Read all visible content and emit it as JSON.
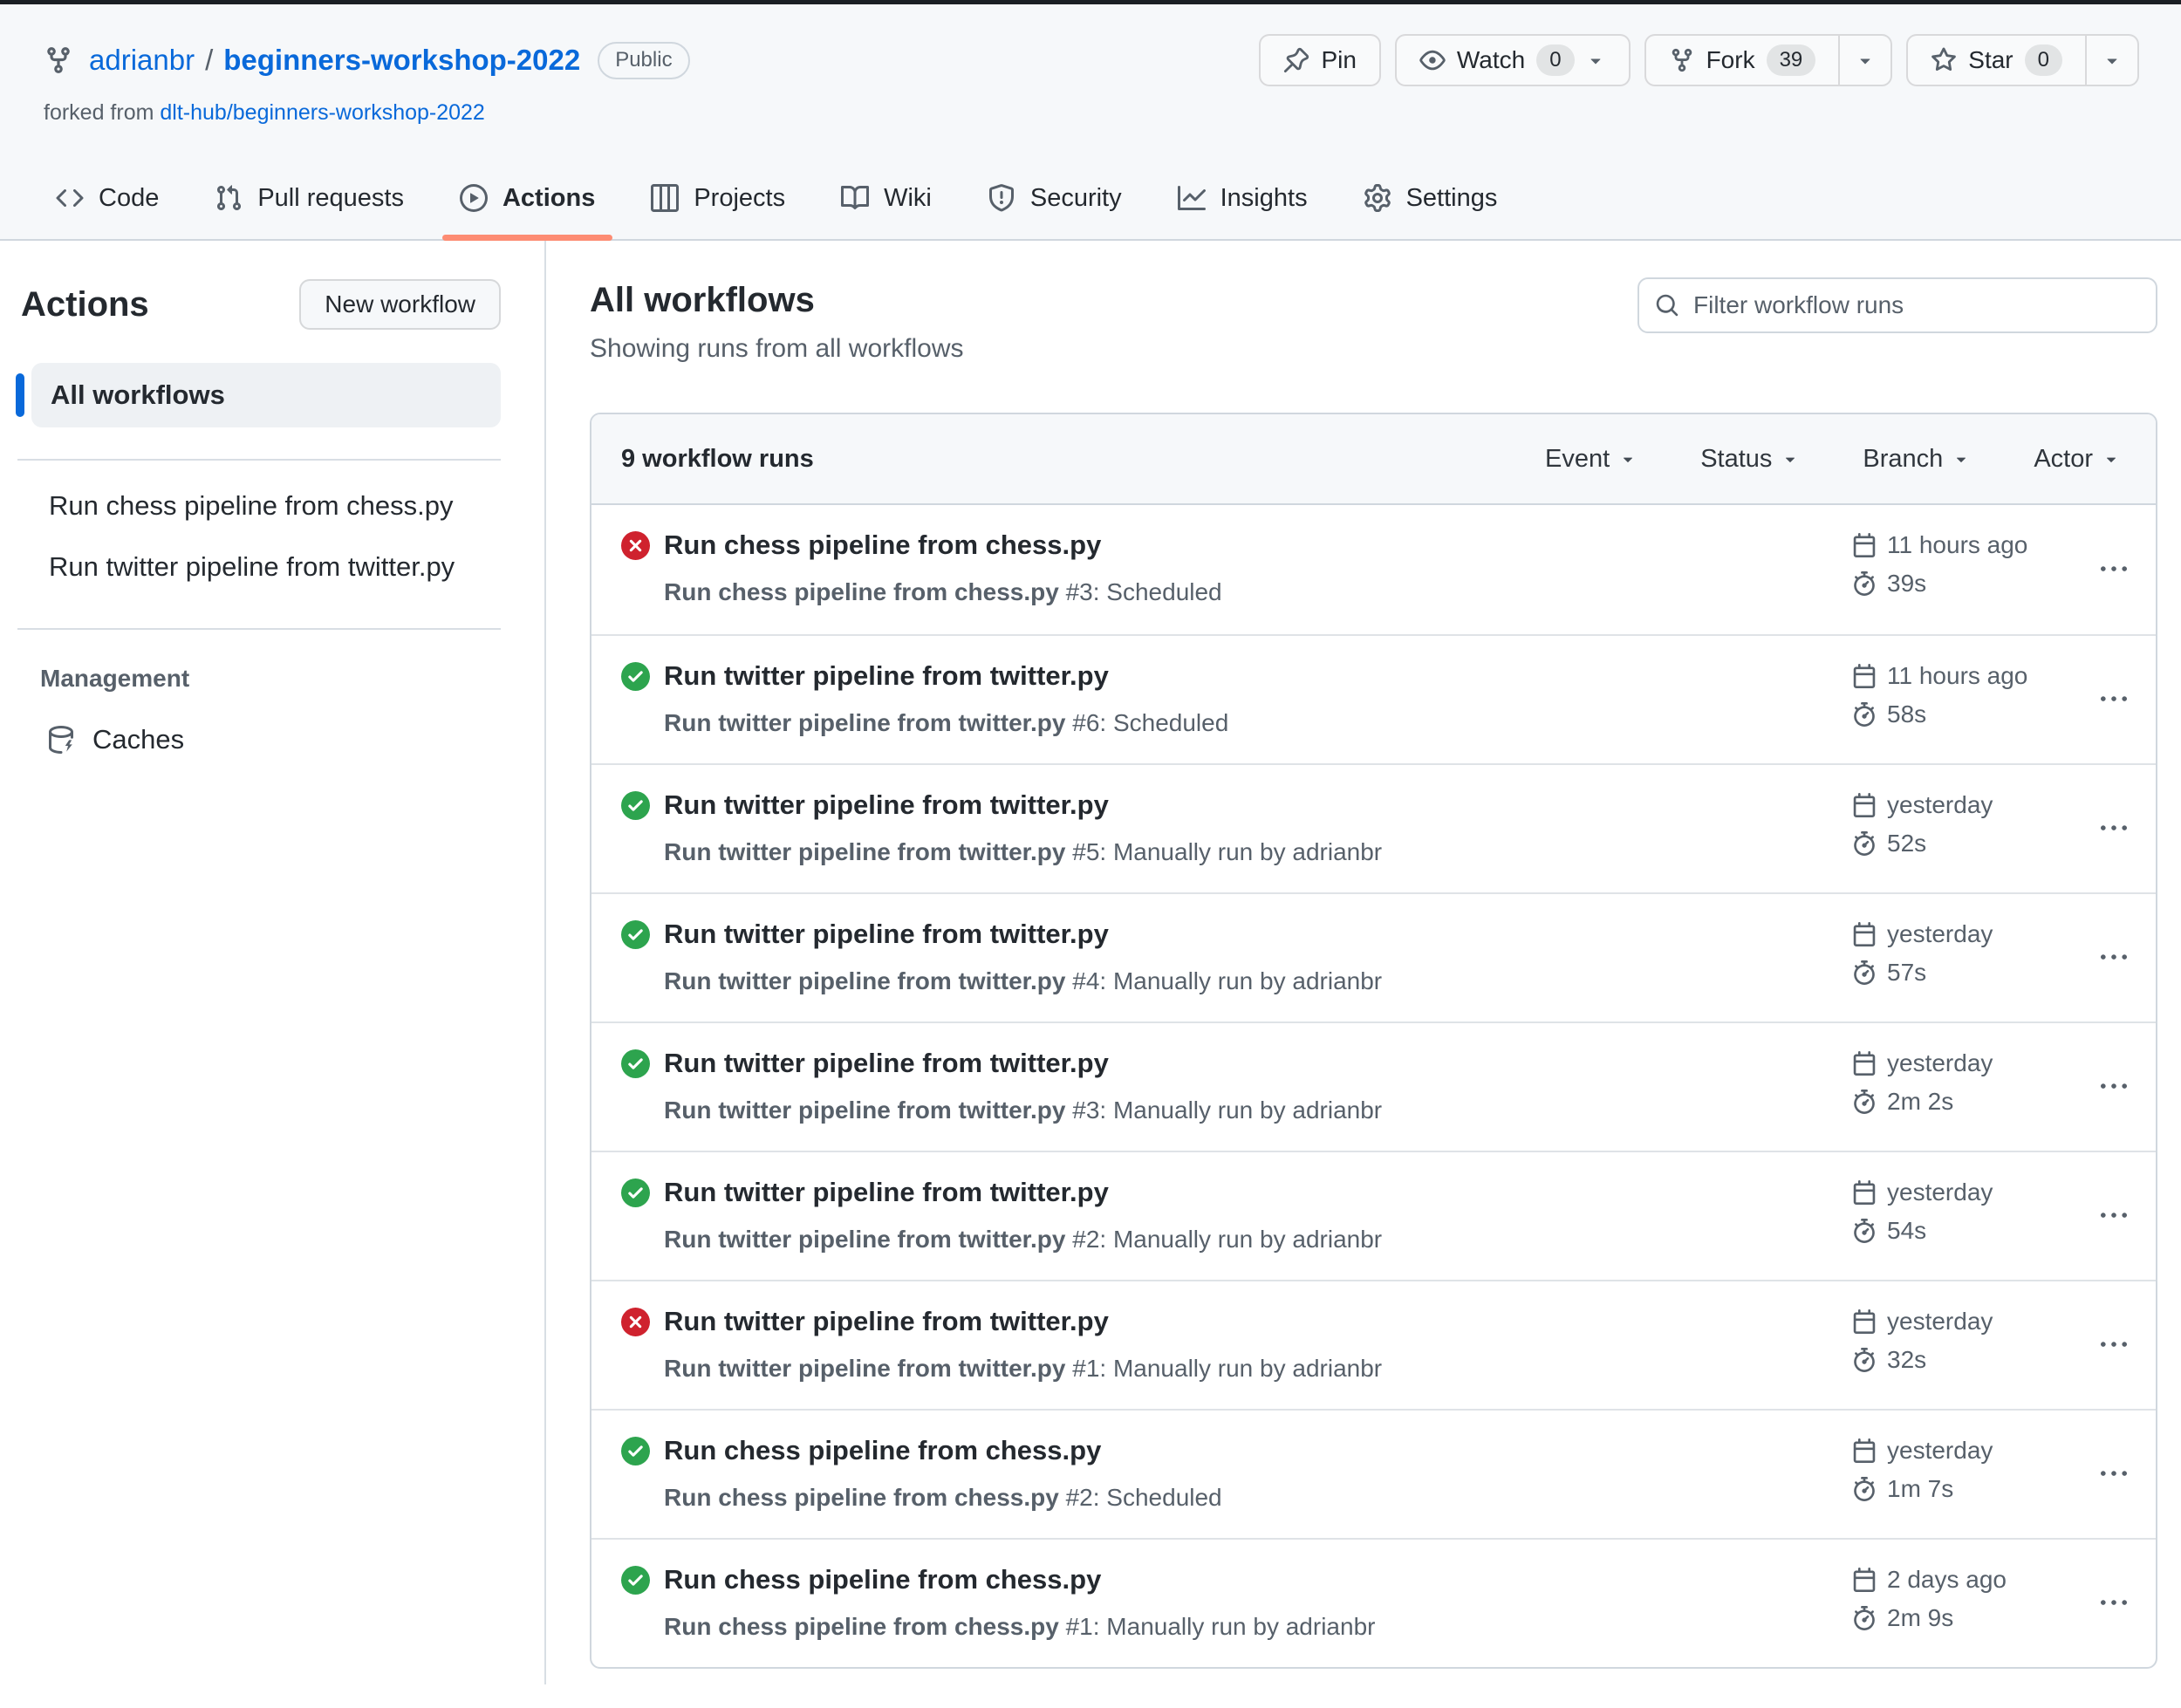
{
  "header": {
    "owner": "adrianbr",
    "separator": "/",
    "repo": "beginners-workshop-2022",
    "visibility_badge": "Public",
    "forked_from_prefix": "forked from",
    "forked_from_link": "dlt-hub/beginners-workshop-2022",
    "buttons": {
      "pin_label": "Pin",
      "watch_label": "Watch",
      "watch_count": "0",
      "fork_label": "Fork",
      "fork_count": "39",
      "star_label": "Star",
      "star_count": "0"
    }
  },
  "nav": {
    "active_tab": "Actions",
    "tabs": [
      "Code",
      "Pull requests",
      "Actions",
      "Projects",
      "Wiki",
      "Security",
      "Insights",
      "Settings"
    ]
  },
  "sidebar": {
    "title": "Actions",
    "new_workflow_button": "New workflow",
    "all_workflows_label": "All workflows",
    "workflows": [
      "Run chess pipeline from chess.py",
      "Run twitter pipeline from twitter.py"
    ],
    "management_label": "Management",
    "caches_label": "Caches"
  },
  "main": {
    "title": "All workflows",
    "subtitle": "Showing runs from all workflows",
    "filter_placeholder": "Filter workflow runs",
    "table": {
      "count_label": "9 workflow runs",
      "filters": [
        "Event",
        "Status",
        "Branch",
        "Actor"
      ]
    }
  },
  "runs": [
    {
      "status": "failure",
      "status_icon": "x-circle-icon",
      "title": "Run chess pipeline from chess.py",
      "subtitle_name": "Run chess pipeline from chess.py",
      "subtitle_detail": "#3: Scheduled",
      "date": "11 hours ago",
      "duration": "39s"
    },
    {
      "status": "success",
      "status_icon": "check-circle-icon",
      "title": "Run twitter pipeline from twitter.py",
      "subtitle_name": "Run twitter pipeline from twitter.py",
      "subtitle_detail": "#6: Scheduled",
      "date": "11 hours ago",
      "duration": "58s"
    },
    {
      "status": "success",
      "status_icon": "check-circle-icon",
      "title": "Run twitter pipeline from twitter.py",
      "subtitle_name": "Run twitter pipeline from twitter.py",
      "subtitle_detail": "#5: Manually run by adrianbr",
      "date": "yesterday",
      "duration": "52s"
    },
    {
      "status": "success",
      "status_icon": "check-circle-icon",
      "title": "Run twitter pipeline from twitter.py",
      "subtitle_name": "Run twitter pipeline from twitter.py",
      "subtitle_detail": "#4: Manually run by adrianbr",
      "date": "yesterday",
      "duration": "57s"
    },
    {
      "status": "success",
      "status_icon": "check-circle-icon",
      "title": "Run twitter pipeline from twitter.py",
      "subtitle_name": "Run twitter pipeline from twitter.py",
      "subtitle_detail": "#3: Manually run by adrianbr",
      "date": "yesterday",
      "duration": "2m 2s"
    },
    {
      "status": "success",
      "status_icon": "check-circle-icon",
      "title": "Run twitter pipeline from twitter.py",
      "subtitle_name": "Run twitter pipeline from twitter.py",
      "subtitle_detail": "#2: Manually run by adrianbr",
      "date": "yesterday",
      "duration": "54s"
    },
    {
      "status": "failure",
      "status_icon": "x-circle-icon",
      "title": "Run twitter pipeline from twitter.py",
      "subtitle_name": "Run twitter pipeline from twitter.py",
      "subtitle_detail": "#1: Manually run by adrianbr",
      "date": "yesterday",
      "duration": "32s"
    },
    {
      "status": "success",
      "status_icon": "check-circle-icon",
      "title": "Run chess pipeline from chess.py",
      "subtitle_name": "Run chess pipeline from chess.py",
      "subtitle_detail": "#2: Scheduled",
      "date": "yesterday",
      "duration": "1m 7s"
    },
    {
      "status": "success",
      "status_icon": "check-circle-icon",
      "title": "Run chess pipeline from chess.py",
      "subtitle_name": "Run chess pipeline from chess.py",
      "subtitle_detail": "#1: Manually run by adrianbr",
      "date": "2 days ago",
      "duration": "2m 9s"
    }
  ],
  "colors": {
    "accent_blue": "#0969da",
    "success_green": "#2da44e",
    "failure_red": "#cf222e",
    "tab_underline": "#fd8c73",
    "header_bg": "#f6f8fa",
    "border_gray": "#d0d7de",
    "muted_text": "#57606a",
    "text": "#24292f"
  }
}
